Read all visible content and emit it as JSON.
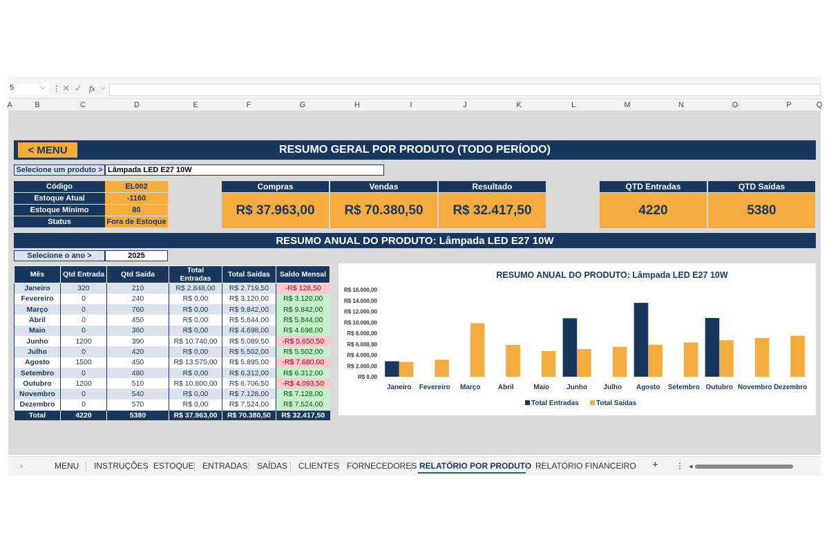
{
  "formula_bar": {
    "name_box": "5",
    "fx_label": "fx"
  },
  "column_headers": [
    "A",
    "B",
    "C",
    "D",
    "E",
    "F",
    "G",
    "H",
    "I",
    "J",
    "K",
    "L",
    "M",
    "N",
    "O",
    "P",
    "Q"
  ],
  "header": {
    "menu_button": "< MENU",
    "title": "RESUMO GERAL POR PRODUTO (TODO PERÍODO)"
  },
  "product_select": {
    "label": "Selecione um produto >",
    "value": "Lâmpada LED E27 10W"
  },
  "product_info": [
    {
      "label": "Código",
      "value": "EL002"
    },
    {
      "label": "Estoque Atual",
      "value": "-1160"
    },
    {
      "label": "Estoque Mínimo",
      "value": "80"
    },
    {
      "label": "Status",
      "value": "Fora de Estoque"
    }
  ],
  "summary_cards": [
    {
      "label": "Compras",
      "value": "R$ 37.963,00"
    },
    {
      "label": "Vendas",
      "value": "R$ 70.380,50"
    },
    {
      "label": "Resultado",
      "value": "R$ 32.417,50"
    },
    {
      "label": "QTD Entradas",
      "value": "4220"
    },
    {
      "label": "QTD Saídas",
      "value": "5380"
    }
  ],
  "annual": {
    "title": "RESUMO ANUAL DO PRODUTO: Lâmpada LED E27 10W",
    "year_label": "Selecione o ano >",
    "year_value": "2025"
  },
  "table": {
    "headers": [
      "Mês",
      "Qtd Entrada",
      "Qtd Saída",
      "Total Entradas",
      "Total Saídas",
      "Saldo Mensal"
    ],
    "rows": [
      [
        "Janeiro",
        "320",
        "210",
        "R$ 2.848,00",
        "R$ 2.719,50",
        "-R$ 128,50"
      ],
      [
        "Fevereiro",
        "0",
        "240",
        "R$ 0,00",
        "R$ 3.120,00",
        "R$ 3.120,00"
      ],
      [
        "Março",
        "0",
        "760",
        "R$ 0,00",
        "R$ 9.842,00",
        "R$ 9.842,00"
      ],
      [
        "Abril",
        "0",
        "450",
        "R$ 0,00",
        "R$ 5.844,00",
        "R$ 5.844,00"
      ],
      [
        "Maio",
        "0",
        "360",
        "R$ 0,00",
        "R$ 4.698,00",
        "R$ 4.698,00"
      ],
      [
        "Junho",
        "1200",
        "390",
        "R$ 10.740,00",
        "R$ 5.089,50",
        "-R$ 5.650,50"
      ],
      [
        "Julho",
        "0",
        "420",
        "R$ 0,00",
        "R$ 5.502,00",
        "R$ 5.502,00"
      ],
      [
        "Agosto",
        "1500",
        "450",
        "R$ 13.575,00",
        "R$ 5.895,00",
        "-R$ 7.680,00"
      ],
      [
        "Setembro",
        "0",
        "480",
        "R$ 0,00",
        "R$ 6.312,00",
        "R$ 6.312,00"
      ],
      [
        "Outubro",
        "1200",
        "510",
        "R$ 10.800,00",
        "R$ 6.706,50",
        "-R$ 4.093,50"
      ],
      [
        "Novembro",
        "0",
        "540",
        "R$ 0,00",
        "R$ 7.128,00",
        "R$ 7.128,00"
      ],
      [
        "Dezembro",
        "0",
        "570",
        "R$ 0,00",
        "R$ 7.524,00",
        "R$ 7.524,00"
      ]
    ],
    "total": [
      "Total",
      "4220",
      "5380",
      "R$ 37.963,00",
      "R$ 70.380,50",
      "R$ 32.417,50"
    ]
  },
  "chart_data": {
    "type": "bar",
    "title": "RESUMO ANUAL DO PRODUTO: Lâmpada LED E27 10W",
    "categories": [
      "Janeiro",
      "Fevereiro",
      "Março",
      "Abril",
      "Maio",
      "Junho",
      "Julho",
      "Agosto",
      "Setembro",
      "Outubro",
      "Novembro",
      "Dezembro"
    ],
    "series": [
      {
        "name": "Total Entradas",
        "color": "#17375e",
        "values": [
          2848,
          0,
          0,
          0,
          0,
          10740,
          0,
          13575,
          0,
          10800,
          0,
          0
        ]
      },
      {
        "name": "Total Saídas",
        "color": "#f4ac3f",
        "values": [
          2719.5,
          3120,
          9842,
          5844,
          4698,
          5089.5,
          5502,
          5895,
          6312,
          6706.5,
          7128,
          7524
        ]
      }
    ],
    "ylim": [
      0,
      16000
    ],
    "y_ticks": [
      "R$ 0,00",
      "R$ 2.000,00",
      "R$ 4.000,00",
      "R$ 6.000,00",
      "R$ 8.000,00",
      "R$ 10.000,00",
      "R$ 12.000,00",
      "R$ 14.000,00",
      "R$ 16.000,00"
    ],
    "legend_position": "bottom",
    "grid": false
  },
  "tabs": [
    {
      "label": "MENU",
      "active": false
    },
    {
      "label": "INSTRUÇÕES",
      "active": false
    },
    {
      "label": "ESTOQUE",
      "active": false
    },
    {
      "label": "ENTRADAS",
      "active": false
    },
    {
      "label": "SAÍDAS",
      "active": false
    },
    {
      "label": "CLIENTES",
      "active": false
    },
    {
      "label": "FORNECEDORES",
      "active": false
    },
    {
      "label": "RELATÓRIO POR PRODUTO",
      "active": true
    },
    {
      "label": "RELATÓRIO FINANCEIRO",
      "active": false
    }
  ],
  "tab_controls": {
    "prev": "›",
    "add": "+",
    "more": "⋮",
    "scroll_left": "◂"
  }
}
